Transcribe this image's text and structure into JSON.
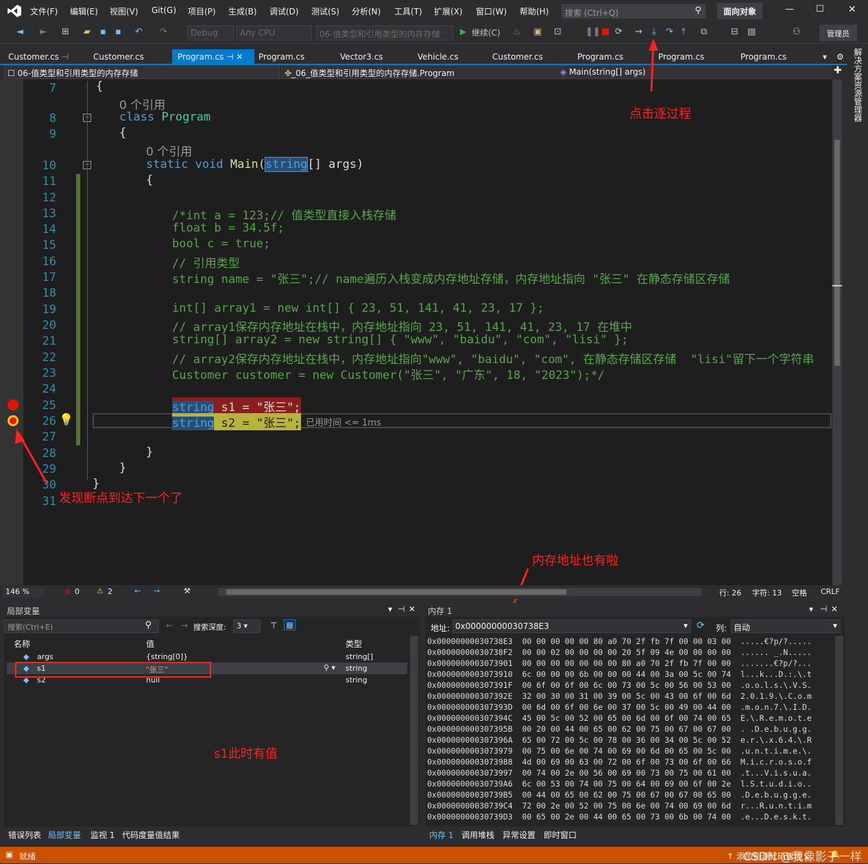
{
  "menu": [
    "文件(F)",
    "编辑(E)",
    "视图(V)",
    "Git(G)",
    "项目(P)",
    "生成(B)",
    "调试(D)",
    "测试(S)",
    "分析(N)",
    "工具(T)",
    "扩展(X)",
    "窗口(W)",
    "帮助(H)"
  ],
  "search_placeholder": "搜索 (Ctrl+Q)",
  "window_title": "面向对象",
  "window_controls": [
    "—",
    "☐",
    "✕"
  ],
  "toolbar": {
    "config": "Debug",
    "platform": "Any CPU",
    "startup": "06-值类型和引用类型的内存存储",
    "continue_label": "继续(C)",
    "admin": "管理员"
  },
  "tabs": [
    "Customer.cs",
    "Customer.cs",
    "Program.cs",
    "Program.cs",
    "Vector3.cs",
    "Vehicle.cs",
    "Customer.cs",
    "Program.cs",
    "Program.cs",
    "Program.cs"
  ],
  "nav": {
    "project": "06-值类型和引用类型的内存存储",
    "class": "_06_值类型和引用类型的内存存储.Program",
    "member": "Main(string[] args)"
  },
  "solution_explorer": "解决方案资源管理器",
  "code": {
    "line_numbers": [
      "7",
      "8",
      "9",
      "10",
      "11",
      "12",
      "13",
      "14",
      "15",
      "16",
      "17",
      "18",
      "19",
      "20",
      "21",
      "22",
      "23",
      "24",
      "25",
      "26",
      "27",
      "28",
      "29",
      "30",
      "31"
    ],
    "ref0": "0 个引用",
    "ref1": "0 个引用",
    "l7": "{",
    "l8_kw": "class",
    "l8_ty": "Program",
    "l9": "{",
    "l10_kw": "static void",
    "l10_fn": "Main(",
    "l10_arg_ty": "string",
    "l10_rest": "[] args)",
    "l11": "{",
    "l13": "/*int a = 123;// 值类型直接入栈存储",
    "l14": "float b = 34.5f;",
    "l15": "bool c = true;",
    "l16": "// 引用类型",
    "l17": "string name = \"张三\";// name遍历入栈变成内存地址存储，内存地址指向 \"张三\" 在静态存储区存储",
    "l19": "int[] array1 = new int[] { 23, 51, 141, 41, 23, 17 };",
    "l20": "// array1保存内存地址在栈中，内存地址指向 23, 51, 141, 41, 23, 17 在堆中",
    "l21": "string[] array2 = new string[] { \"www\", \"baidu\", \"com\", \"lisi\" };",
    "l22": "// array2保存内存地址在栈中，内存地址指向\"www\", \"baidu\", \"com\", 在静态存储区存储  \"lisi\"留下一个字符串",
    "l23": "Customer customer = new Customer(\"张三\", \"广东\", 18, \"2023\");*/",
    "l25_ty": "string",
    "l25_rest": " s1 = \"张三\";",
    "l26_ty": "string",
    "l26_rest": " s2 = \"张三\";",
    "elapsed": "已用时间 <= 1ms",
    "l28": "}",
    "l29": "}",
    "l30": "}"
  },
  "annotations": {
    "step_over": "点击逐过程",
    "breakpoint_next": "发现断点到达下一个了",
    "mem_addr": "内存地址也有啦",
    "s1_value": "s1此时有值"
  },
  "editor_status": {
    "zoom": "146 %",
    "errors": "0",
    "warnings": "2",
    "line": "行: 26",
    "col": "字符: 13",
    "space": "空格",
    "eol": "CRLF"
  },
  "locals": {
    "title": "局部变量",
    "search": "搜索(Ctrl+E)",
    "depth_label": "搜索深度:",
    "depth": "3",
    "headers": [
      "名称",
      "值",
      "类型"
    ],
    "rows": [
      {
        "name": "args",
        "value": "{string[0]}",
        "type": "string[]"
      },
      {
        "name": "s1",
        "value": "\"张三\"",
        "type": "string"
      },
      {
        "name": "s2",
        "value": "null",
        "type": "string"
      }
    ]
  },
  "memory": {
    "title": "内存 1",
    "addr_label": "地址:",
    "address": "0x00000000030738E3",
    "col_label": "列:",
    "col": "自动",
    "rows": [
      [
        "0x00000000030738E3",
        "00 00 00 00 00 80 a0 70 2f fb 7f 00 00 03 00",
        ".....€?p/?....."
      ],
      [
        "0x00000000030738F2",
        "00 00 02 00 00 00 00 20 5f 09 4e 00 00 00 00",
        "...... _.N....."
      ],
      [
        "0x0000000003073901",
        "00 00 00 00 00 00 00 80 a0 70 2f fb 7f 00 00",
        ".......€?p/?..."
      ],
      [
        "0x0000000003073910",
        "6c 00 00 00 6b 00 00 00 44 00 3a 00 5c 00 74",
        "l...k...D.:.\\.t"
      ],
      [
        "0x000000000307391F",
        "00 6f 00 6f 00 6c 00 73 00 5c 00 56 00 53 00",
        ".o.o.l.s.\\.V.S."
      ],
      [
        "0x000000000307392E",
        "32 00 30 00 31 00 39 00 5c 00 43 00 6f 00 6d",
        "2.0.1.9.\\.C.o.m"
      ],
      [
        "0x000000000307393D",
        "00 6d 00 6f 00 6e 00 37 00 5c 00 49 00 44 00",
        ".m.o.n.7.\\.I.D."
      ],
      [
        "0x000000000307394C",
        "45 00 5c 00 52 00 65 00 6d 00 6f 00 74 00 65",
        "E.\\.R.e.m.o.t.e"
      ],
      [
        "0x000000000307395B",
        "00 20 00 44 00 65 00 62 00 75 00 67 00 67 00",
        ". .D.e.b.u.g.g."
      ],
      [
        "0x000000000307396A",
        "65 00 72 00 5c 00 78 00 36 00 34 00 5c 00 52",
        "e.r.\\.x.6.4.\\.R"
      ],
      [
        "0x0000000003073979",
        "00 75 00 6e 00 74 00 69 00 6d 00 65 00 5c 00",
        ".u.n.t.i.m.e.\\."
      ],
      [
        "0x0000000003073988",
        "4d 00 69 00 63 00 72 00 6f 00 73 00 6f 00 66",
        "M.i.c.r.o.s.o.f"
      ],
      [
        "0x0000000003073997",
        "00 74 00 2e 00 56 00 69 00 73 00 75 00 61 00",
        ".t...V.i.s.u.a."
      ],
      [
        "0x00000000030739A6",
        "6c 00 53 00 74 00 75 00 64 00 69 00 6f 00 2e",
        "l.S.t.u.d.i.o.."
      ],
      [
        "0x00000000030739B5",
        "00 44 00 65 00 62 00 75 00 67 00 67 00 65 00",
        ".D.e.b.u.g.g.e."
      ],
      [
        "0x00000000030739C4",
        "72 00 2e 00 52 00 75 00 6e 00 74 00 69 00 6d",
        "r...R.u.n.t.i.m"
      ],
      [
        "0x00000000030739D3",
        "00 65 00 2e 00 44 00 65 00 73 00 6b 00 74 00",
        ".e...D.e.s.k.t."
      ]
    ]
  },
  "bottom_tabs_left": [
    "错误列表",
    "局部变量",
    "监视 1",
    "代码度量值结果"
  ],
  "bottom_tabs_right": [
    "内存 1",
    "调用堆栈",
    "异常设置",
    "即时窗口"
  ],
  "status": {
    "ready": "就绪",
    "source_control": "添加到源代码管理",
    "watermark": "CSDN @我像影子一样"
  },
  "colors": {
    "accent": "#007acc",
    "statusbar": "#ca5100",
    "annotation": "#ff2020",
    "breakpoint": "#e51400"
  }
}
